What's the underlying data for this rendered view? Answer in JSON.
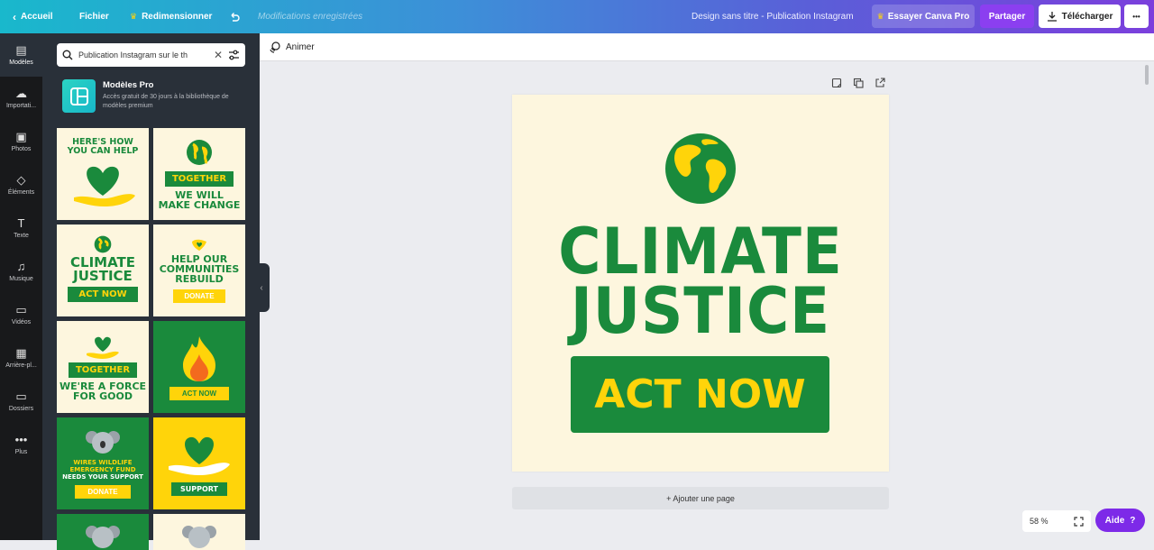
{
  "topbar": {
    "home_label": "Accueil",
    "file_label": "Fichier",
    "resize_label": "Redimensionner",
    "saved_label": "Modifications enregistrées",
    "doc_title": "Design sans titre - Publication Instagram",
    "try_pro_label": "Essayer Canva Pro",
    "share_label": "Partager",
    "download_label": "Télécharger",
    "more_label": "•••"
  },
  "sidebar": {
    "items": [
      {
        "label": "Modèles",
        "icon": "template-icon"
      },
      {
        "label": "Importati...",
        "icon": "upload-icon"
      },
      {
        "label": "Photos",
        "icon": "photo-icon"
      },
      {
        "label": "Éléments",
        "icon": "elements-icon"
      },
      {
        "label": "Texte",
        "icon": "text-icon"
      },
      {
        "label": "Musique",
        "icon": "music-icon"
      },
      {
        "label": "Vidéos",
        "icon": "video-icon"
      },
      {
        "label": "Arrière-pl...",
        "icon": "background-icon"
      },
      {
        "label": "Dossiers",
        "icon": "folder-icon"
      },
      {
        "label": "Plus",
        "icon": "more-icon"
      }
    ]
  },
  "panel": {
    "search_value": "Publication Instagram sur le th",
    "promo_title": "Modèles Pro",
    "promo_desc": "Accès gratuit de 30 jours à la bibliothèque de modèles premium",
    "templates": [
      {
        "lines": [
          "HERE'S HOW",
          "YOU CAN HELP"
        ],
        "style": "cream"
      },
      {
        "lines": [
          "TOGETHER",
          "WE WILL",
          "MAKE CHANGE"
        ],
        "style": "cream"
      },
      {
        "lines": [
          "CLIMATE",
          "JUSTICE",
          "ACT NOW"
        ],
        "style": "cream"
      },
      {
        "lines": [
          "HELP OUR",
          "COMMUNITIES",
          "REBUILD",
          "DONATE"
        ],
        "style": "cream"
      },
      {
        "lines": [
          "TOGETHER",
          "WE'RE A FORCE",
          "FOR GOOD"
        ],
        "style": "cream"
      },
      {
        "lines": [
          "ACT NOW"
        ],
        "style": "green"
      },
      {
        "lines": [
          "WIRES WILDLIFE",
          "EMERGENCY FUND",
          "NEEDS YOUR SUPPORT",
          "DONATE"
        ],
        "style": "green"
      },
      {
        "lines": [
          "SUPPORT"
        ],
        "style": "yellow"
      }
    ]
  },
  "editor": {
    "animate_label": "Animer",
    "canvas_line1": "CLIMATE",
    "canvas_line2": "JUSTICE",
    "canvas_button": "ACT NOW",
    "add_page_label": "+ Ajouter une page",
    "zoom": "58 %",
    "help_label": "Aide",
    "help_icon_label": "?"
  },
  "colors": {
    "green": "#1a8a3c",
    "yellow": "#ffd40a",
    "cream": "#fdf6de",
    "pro_purple": "#7d2ae8"
  }
}
